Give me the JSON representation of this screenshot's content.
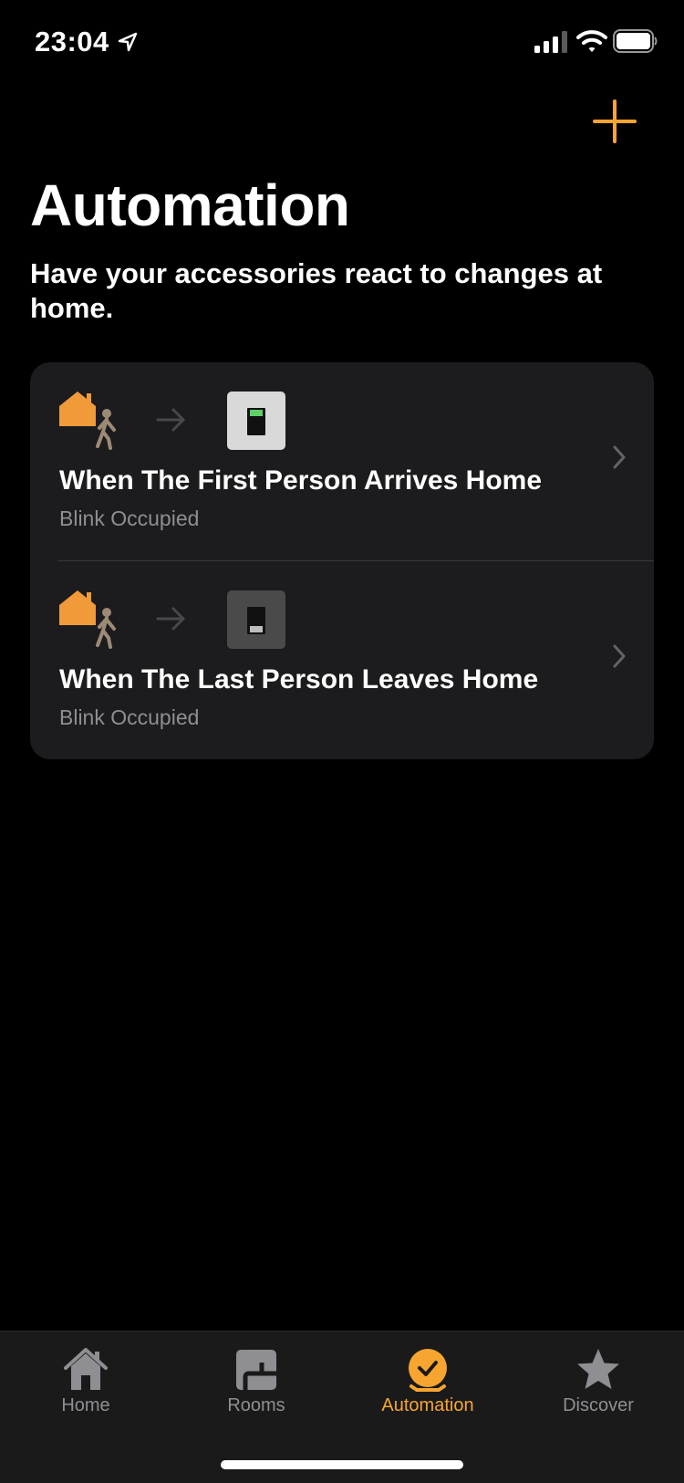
{
  "status_bar": {
    "time": "23:04"
  },
  "header": {
    "title": "Automation",
    "subtitle": "Have your accessories react to changes at home.",
    "add_icon": "plus-icon"
  },
  "automations": [
    {
      "title": "When The First Person Arrives Home",
      "subtitle": "Blink Occupied",
      "trigger_icon": "home-person-arrive-icon",
      "switch_state": "on"
    },
    {
      "title": "When The Last Person Leaves Home",
      "subtitle": "Blink Occupied",
      "trigger_icon": "home-person-leave-icon",
      "switch_state": "off"
    }
  ],
  "tab_bar": {
    "tabs": [
      {
        "label": "Home",
        "icon": "house-icon",
        "active": false
      },
      {
        "label": "Rooms",
        "icon": "rooms-icon",
        "active": false
      },
      {
        "label": "Automation",
        "icon": "clock-check-icon",
        "active": true
      },
      {
        "label": "Discover",
        "icon": "star-icon",
        "active": false
      }
    ]
  },
  "colors": {
    "accent": "#f7a531",
    "card": "#1c1c1e",
    "secondary_text": "#8e8e93",
    "background": "#000000"
  }
}
